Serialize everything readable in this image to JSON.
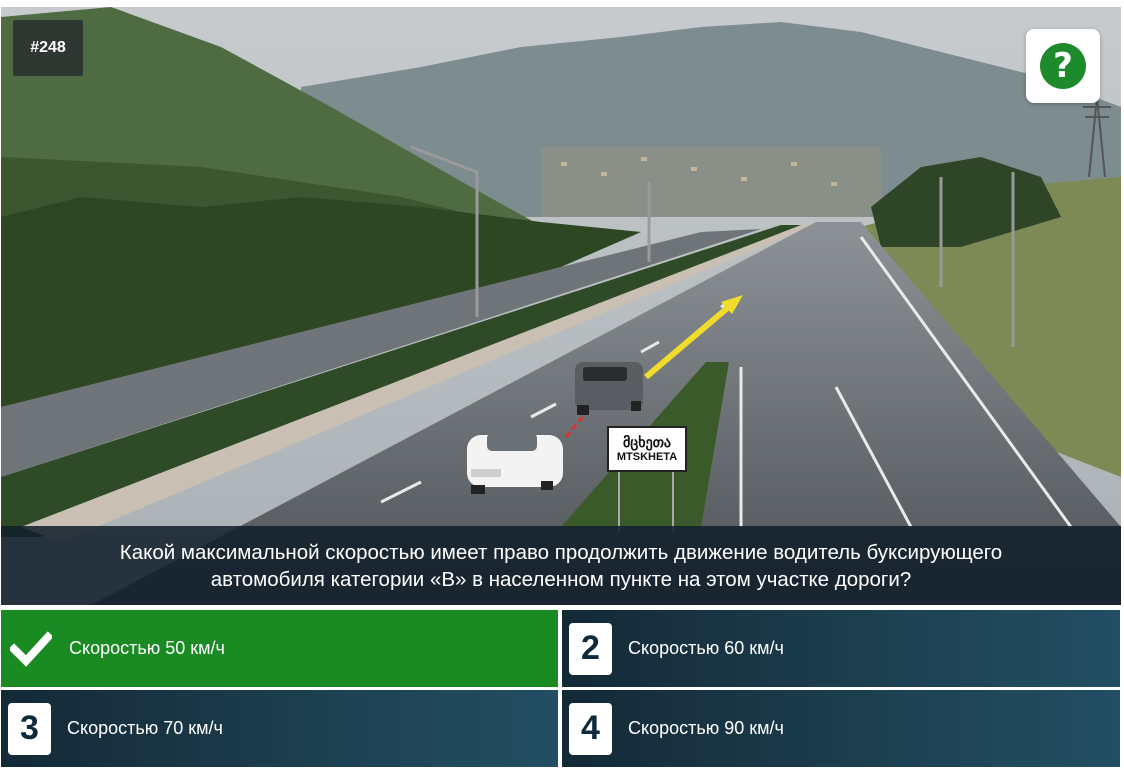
{
  "question_number": "#248",
  "help_icon": "question-mark-icon",
  "question_text": "Какой максимальной скоростью имеет право продолжить движение водитель буксирующего автомобиля категории «В» в населенном пункте на этом участке дороги?",
  "sign": {
    "line1": "მცხეთა",
    "line2": "MTSKHETA"
  },
  "answers": [
    {
      "marker": "check-icon",
      "text": "Скоростью 50 км/ч",
      "state": "correct"
    },
    {
      "marker": "2",
      "text": "Скоростью 60 км/ч",
      "state": "default"
    },
    {
      "marker": "3",
      "text": "Скоростью 70 км/ч",
      "state": "default"
    },
    {
      "marker": "4",
      "text": "Скоростью 90 км/ч",
      "state": "default"
    }
  ],
  "colors": {
    "correct": "#1a8a22",
    "answer_bg": "#1d4152",
    "help": "#1d8a2b"
  }
}
